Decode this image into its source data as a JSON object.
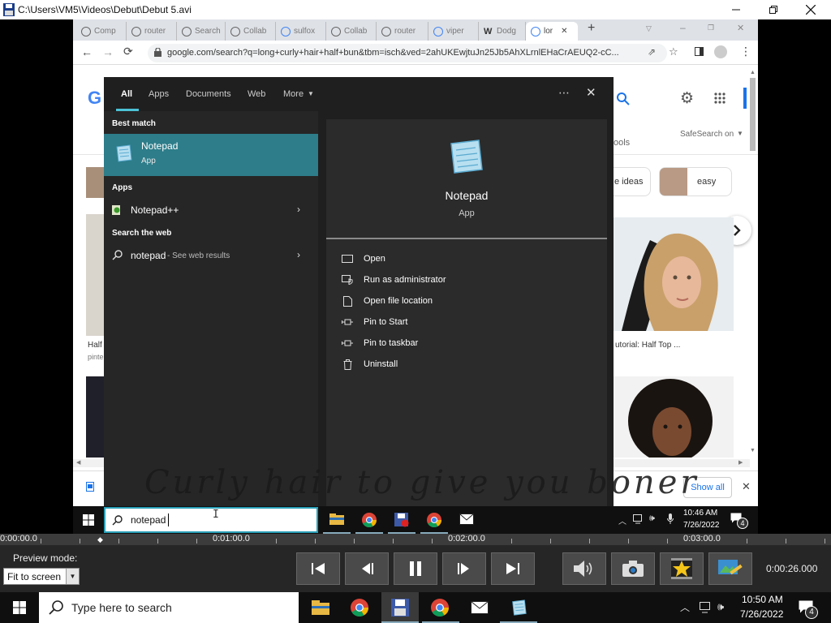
{
  "player": {
    "title": "C:\\Users\\VM5\\Videos\\Debut\\Debut 5.avi",
    "preview_label": "Preview mode:",
    "preview_value": "Fit to screen",
    "timecode": "0:00:26.000",
    "timeline": [
      "0:00:00.0",
      "0:01:00.0",
      "0:02:00.0",
      "0:03:00.0"
    ]
  },
  "browser": {
    "tabs": [
      {
        "label": "Comp",
        "icon": "globe-icon"
      },
      {
        "label": "router",
        "icon": "globe-icon"
      },
      {
        "label": "Search",
        "icon": "globe-icon"
      },
      {
        "label": "Collab",
        "icon": "globe-icon"
      },
      {
        "label": "sulfox",
        "icon": "google-icon"
      },
      {
        "label": "Collab",
        "icon": "globe-icon"
      },
      {
        "label": "router",
        "icon": "globe-icon"
      },
      {
        "label": "viper",
        "icon": "google-icon"
      },
      {
        "label": "Dodg",
        "icon": "wikipedia-icon"
      },
      {
        "label": "lor",
        "icon": "google-icon"
      }
    ],
    "url": "google.com/search?q=long+curly+hair+half+bun&tbm=isch&ved=2ahUKEwjtuJn25Jb5AhXLrnlEHaCrAEUQ2-cC...",
    "safesearch": "SafeSearch on",
    "tools_partial": "ools",
    "chips": [
      "e ideas",
      "easy"
    ],
    "captions": {
      "left": "Half",
      "left_sub": "pinte",
      "right": "utorial: Half Top ..."
    },
    "show_all": "Show all"
  },
  "start_menu": {
    "tabs": [
      "All",
      "Apps",
      "Documents",
      "Web",
      "More"
    ],
    "best_match_header": "Best match",
    "best_match": {
      "name": "Notepad",
      "type": "App"
    },
    "apps_header": "Apps",
    "apps": [
      {
        "name": "Notepad++"
      }
    ],
    "web_header": "Search the web",
    "web": {
      "query": "notepad",
      "suffix": " - See web results"
    },
    "detail": {
      "name": "Notepad",
      "type": "App"
    },
    "actions": [
      "Open",
      "Run as administrator",
      "Open file location",
      "Pin to Start",
      "Pin to taskbar",
      "Uninstall"
    ],
    "search_value": "notepad"
  },
  "inner_taskbar": {
    "time": "10:46 AM",
    "date": "7/26/2022",
    "notif": "4"
  },
  "overlay_text": "Curly hair to give you boner",
  "taskbar": {
    "search_placeholder": "Type here to search",
    "time": "10:50 AM",
    "date": "7/26/2022",
    "notif": "4"
  },
  "colors": {
    "accent": "#2d7d8a",
    "search_border": "#2aa0b8",
    "player_bg": "#262626"
  }
}
